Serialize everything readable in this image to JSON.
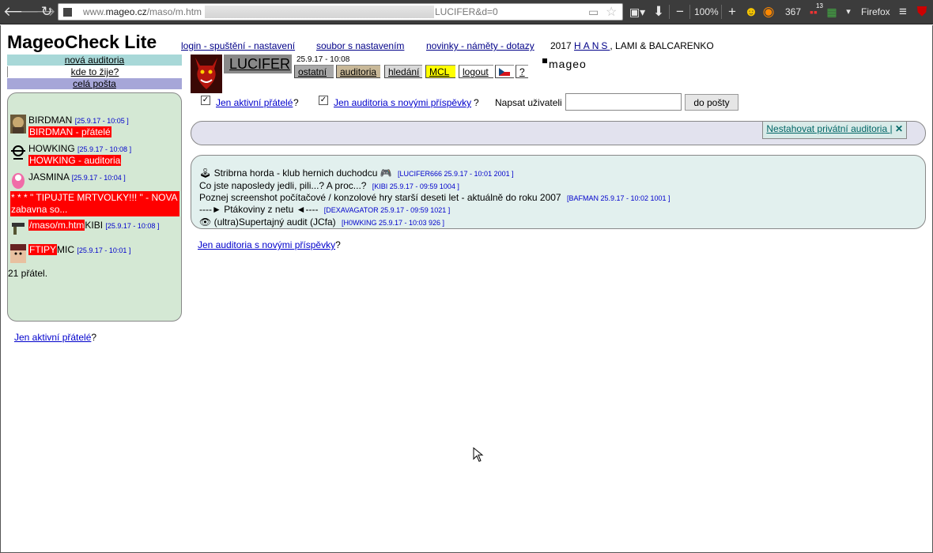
{
  "browser": {
    "url_prefix": "www.",
    "url_host": "mageo.cz",
    "url_path": "/maso/m.htm",
    "url_tail": "LUCIFER&d=0",
    "zoom": "100%",
    "counter": "367",
    "notif_count": "13",
    "app_name": "Firefox"
  },
  "header": {
    "site_title": "MageoCheck Lite",
    "links": [
      "login - spuštění - nastavení",
      "soubor s nastavením",
      "novinky - náměty - dotazy"
    ],
    "credits_year": "2017 ",
    "credits_link": "HANS",
    "credits_rest": ", LAMI & BALCARENKO"
  },
  "left_nav": {
    "new_audit": "nová auditoria",
    "where_lives": "kde to žije?",
    "all_mail": "celá pošta"
  },
  "friends": [
    {
      "name": "BIRDMAN",
      "date": "[25.9.17 - 10:05 ]",
      "tag": "BIRDMAN - přátelé",
      "avatar": "bird-avatar-icon"
    },
    {
      "name": "HOWKING",
      "date": "[25.9.17 - 10:08 ]",
      "tag": "HOWKING - auditoria",
      "avatar": "gear-avatar-icon"
    },
    {
      "name": "JASMINA",
      "date": "[25.9.17 - 10:04 ]",
      "tag": "",
      "avatar": "pink-avatar-icon"
    },
    {
      "name": "KIBI",
      "date": "[25.9.17 - 10:08 ]",
      "tag_prefix": "/maso/m.htm",
      "avatar": "gun-avatar-icon"
    },
    {
      "name": "MIC",
      "date": "[25.9.17 - 10:01 ]",
      "tag_prefix": "FTIPY",
      "avatar": "face-avatar-icon"
    }
  ],
  "red_message": "* * * \" TIPUJTE MRTVOLKY!!! \" - NOVA zabavna so...",
  "friend_count": "21 přátel.",
  "left_bottom": {
    "link": "Jen aktivní přátelé",
    "suffix": "?"
  },
  "user": {
    "name": "LUCIFER",
    "time": "25.9.17 - 10:08",
    "tabs": [
      "ostatní",
      "auditoria",
      "hledání",
      "MCL",
      "logout",
      "",
      "?"
    ],
    "mageo_logo": "mageo"
  },
  "filters": {
    "active_friends": "Jen aktivní přátelé",
    "new_posts": "Jen auditoria s novými příspěvky",
    "q": "?",
    "write_label": "Napsat uživateli",
    "write_value": "",
    "write_button": "do pošty"
  },
  "private": {
    "link": "Nestahovat privátní auditoria |",
    "close": "✕"
  },
  "forums": [
    {
      "icon": "🕹",
      "title": "Stribrna horda - klub hernich duchodcu 🎮",
      "meta": "[LUCIFER666 25.9.17 - 10:01 2001 ]"
    },
    {
      "icon": "",
      "title": "Co jste naposledy jedli, pili...? A proc...?",
      "meta": "[KIBI 25.9.17 - 09:59 1004 ]"
    },
    {
      "icon": "",
      "title": "Poznej screenshot počítačové / konzolové hry starší deseti let - aktuálně do roku 2007",
      "meta": "[BAFMAN 25.9.17 - 10:02 1001 ]"
    },
    {
      "icon": "",
      "title": "----► Ptákoviny z netu ◄----",
      "meta": "[DEXAVAGATOR 25.9.17 - 09:59 1021 ]"
    },
    {
      "icon": "👁",
      "title": "(ultra)Supertajný audit (JCfa)",
      "meta": "[H0WKING 25.9.17 - 10:03 926 ]"
    }
  ],
  "bottom": {
    "link": "Jen auditoria s novými příspěvky",
    "suffix": "?"
  }
}
